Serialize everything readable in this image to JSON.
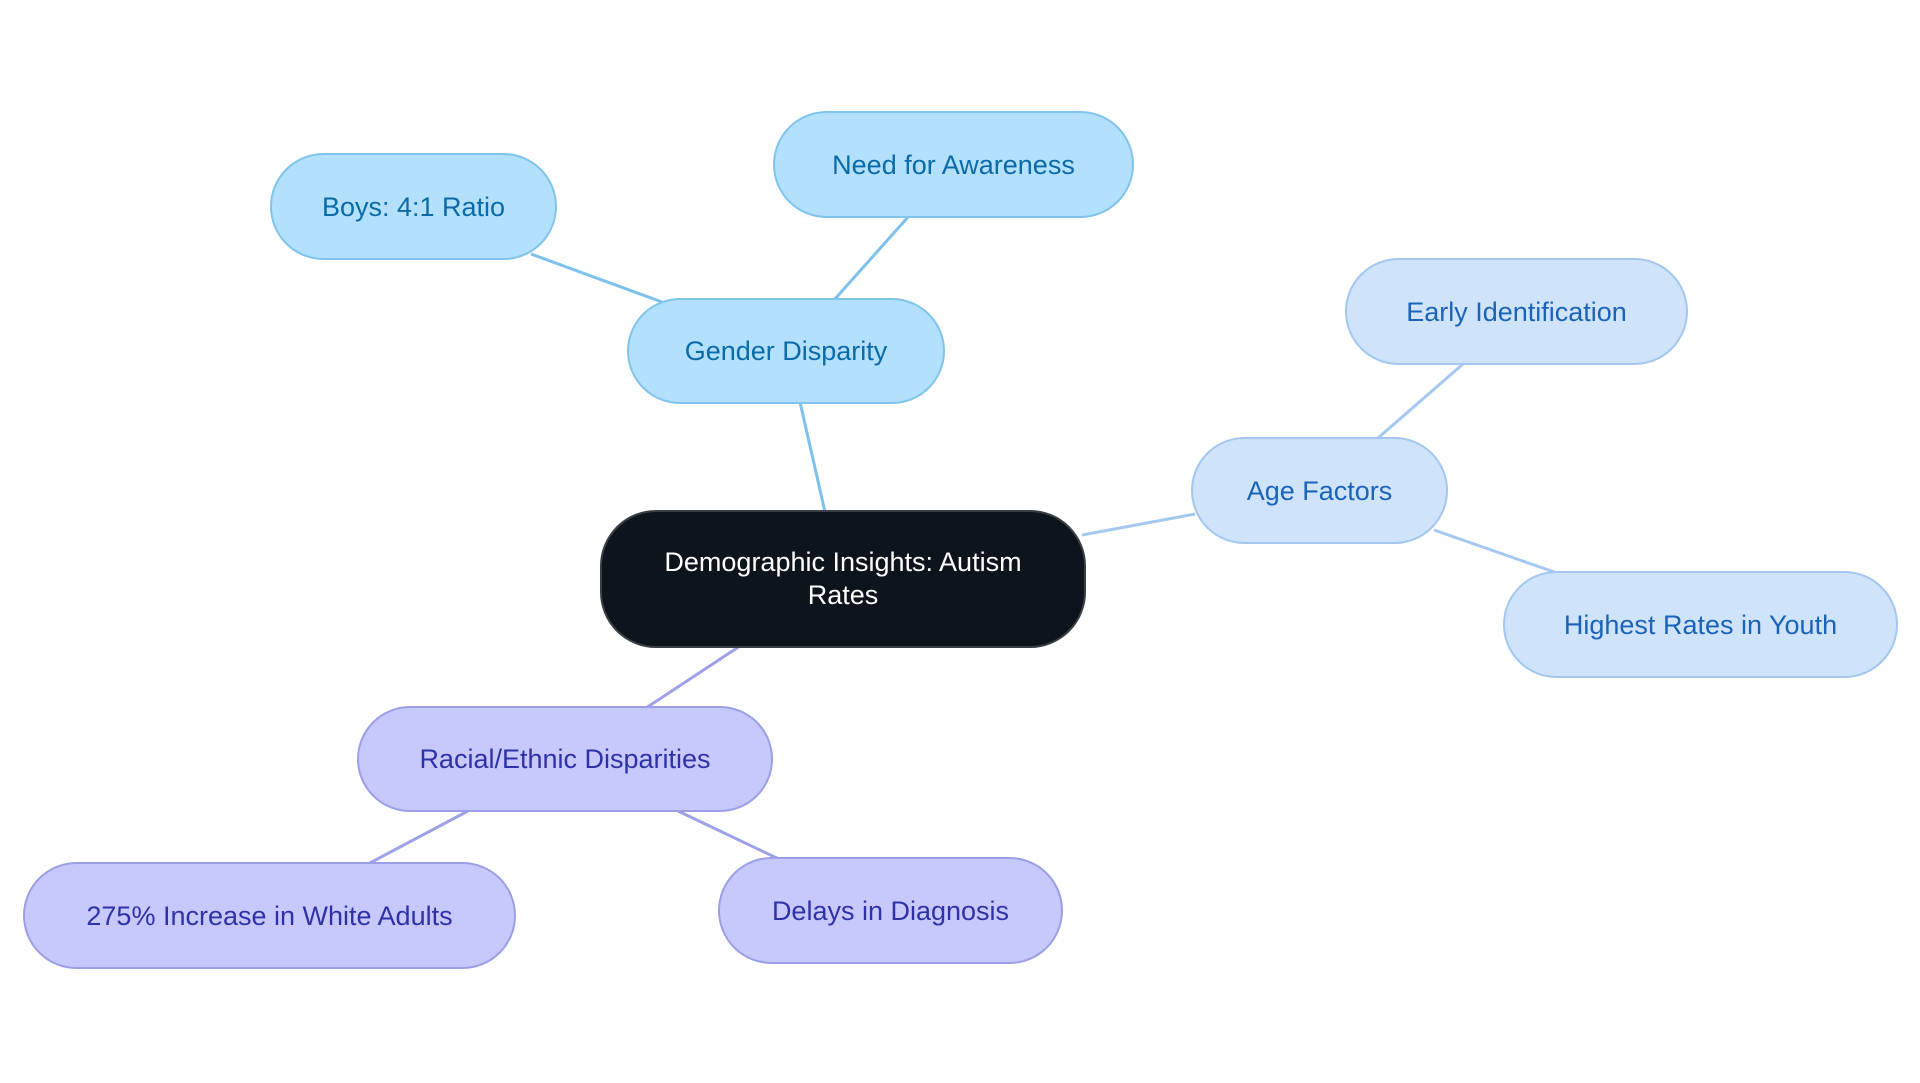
{
  "diagram": {
    "type": "mind-map",
    "root": {
      "id": "root",
      "label": "Demographic Insights: Autism Rates",
      "colors": {
        "fill": "#0d141b",
        "text": "#ffffff"
      }
    },
    "branches": [
      {
        "id": "gender",
        "label": "Gender Disparity",
        "colors": {
          "fill": "#b3e0fd",
          "border": "#80c4ec",
          "text": "#0b6aa8",
          "edge": "#7dc1ec"
        },
        "children": [
          {
            "id": "boys",
            "label": "Boys: 4:1 Ratio"
          },
          {
            "id": "awareness",
            "label": "Need for Awareness"
          }
        ]
      },
      {
        "id": "age",
        "label": "Age Factors",
        "colors": {
          "fill": "#cfe4fb",
          "border": "#a3c7ef",
          "text": "#1b63b8",
          "edge": "#a5c8f0"
        },
        "children": [
          {
            "id": "early",
            "label": "Early Identification"
          },
          {
            "id": "youth",
            "label": "Highest Rates in Youth"
          }
        ]
      },
      {
        "id": "race",
        "label": "Racial/Ethnic Disparities",
        "colors": {
          "fill": "#c7c9fd",
          "border": "#9c9fe6",
          "text": "#2f32a6",
          "edge": "#9ea1e8"
        },
        "children": [
          {
            "id": "white",
            "label": "275% Increase in White Adults"
          },
          {
            "id": "delays",
            "label": "Delays in Diagnosis"
          }
        ]
      }
    ]
  }
}
